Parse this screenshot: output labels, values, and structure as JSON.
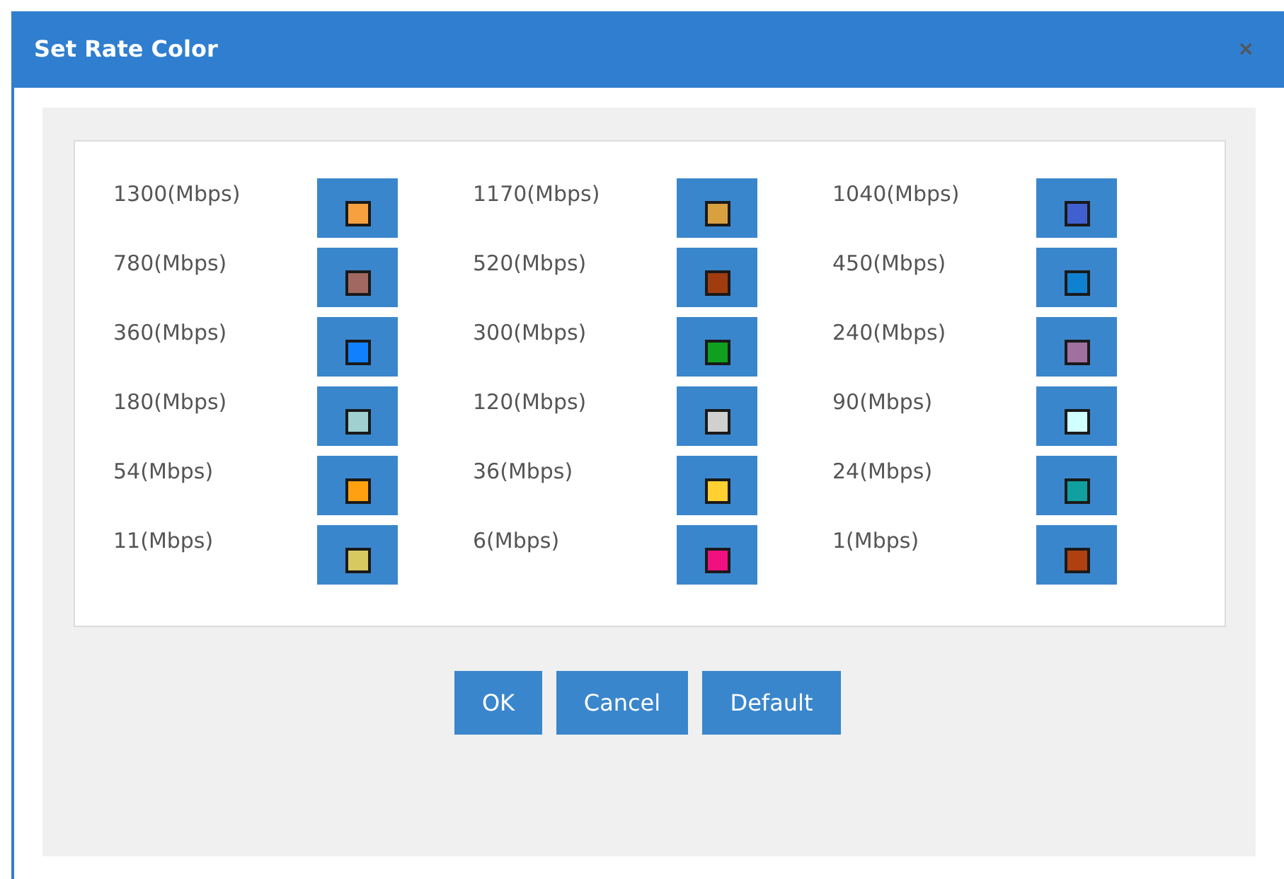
{
  "window": {
    "title": "Set Rate Color",
    "close": "×"
  },
  "rates": [
    {
      "label": "1300(Mbps)",
      "color": "#f7a040"
    },
    {
      "label": "1170(Mbps)",
      "color": "#d9a040"
    },
    {
      "label": "1040(Mbps)",
      "color": "#4060d0"
    },
    {
      "label": "780(Mbps)",
      "color": "#a06860"
    },
    {
      "label": "520(Mbps)",
      "color": "#a03c10"
    },
    {
      "label": "450(Mbps)",
      "color": "#1080d0"
    },
    {
      "label": "360(Mbps)",
      "color": "#1080ff"
    },
    {
      "label": "300(Mbps)",
      "color": "#10a020"
    },
    {
      "label": "240(Mbps)",
      "color": "#a070a0"
    },
    {
      "label": "180(Mbps)",
      "color": "#a0d0d0"
    },
    {
      "label": "120(Mbps)",
      "color": "#d0d0d0"
    },
    {
      "label": "90(Mbps)",
      "color": "#d0ffff"
    },
    {
      "label": "54(Mbps)",
      "color": "#ffa010"
    },
    {
      "label": "36(Mbps)",
      "color": "#ffd030"
    },
    {
      "label": "24(Mbps)",
      "color": "#10a0a0"
    },
    {
      "label": "11(Mbps)",
      "color": "#d8c860"
    },
    {
      "label": "6(Mbps)",
      "color": "#f01080"
    },
    {
      "label": "1(Mbps)",
      "color": "#b04010"
    }
  ],
  "buttons": [
    "OK",
    "Cancel",
    "Default"
  ]
}
